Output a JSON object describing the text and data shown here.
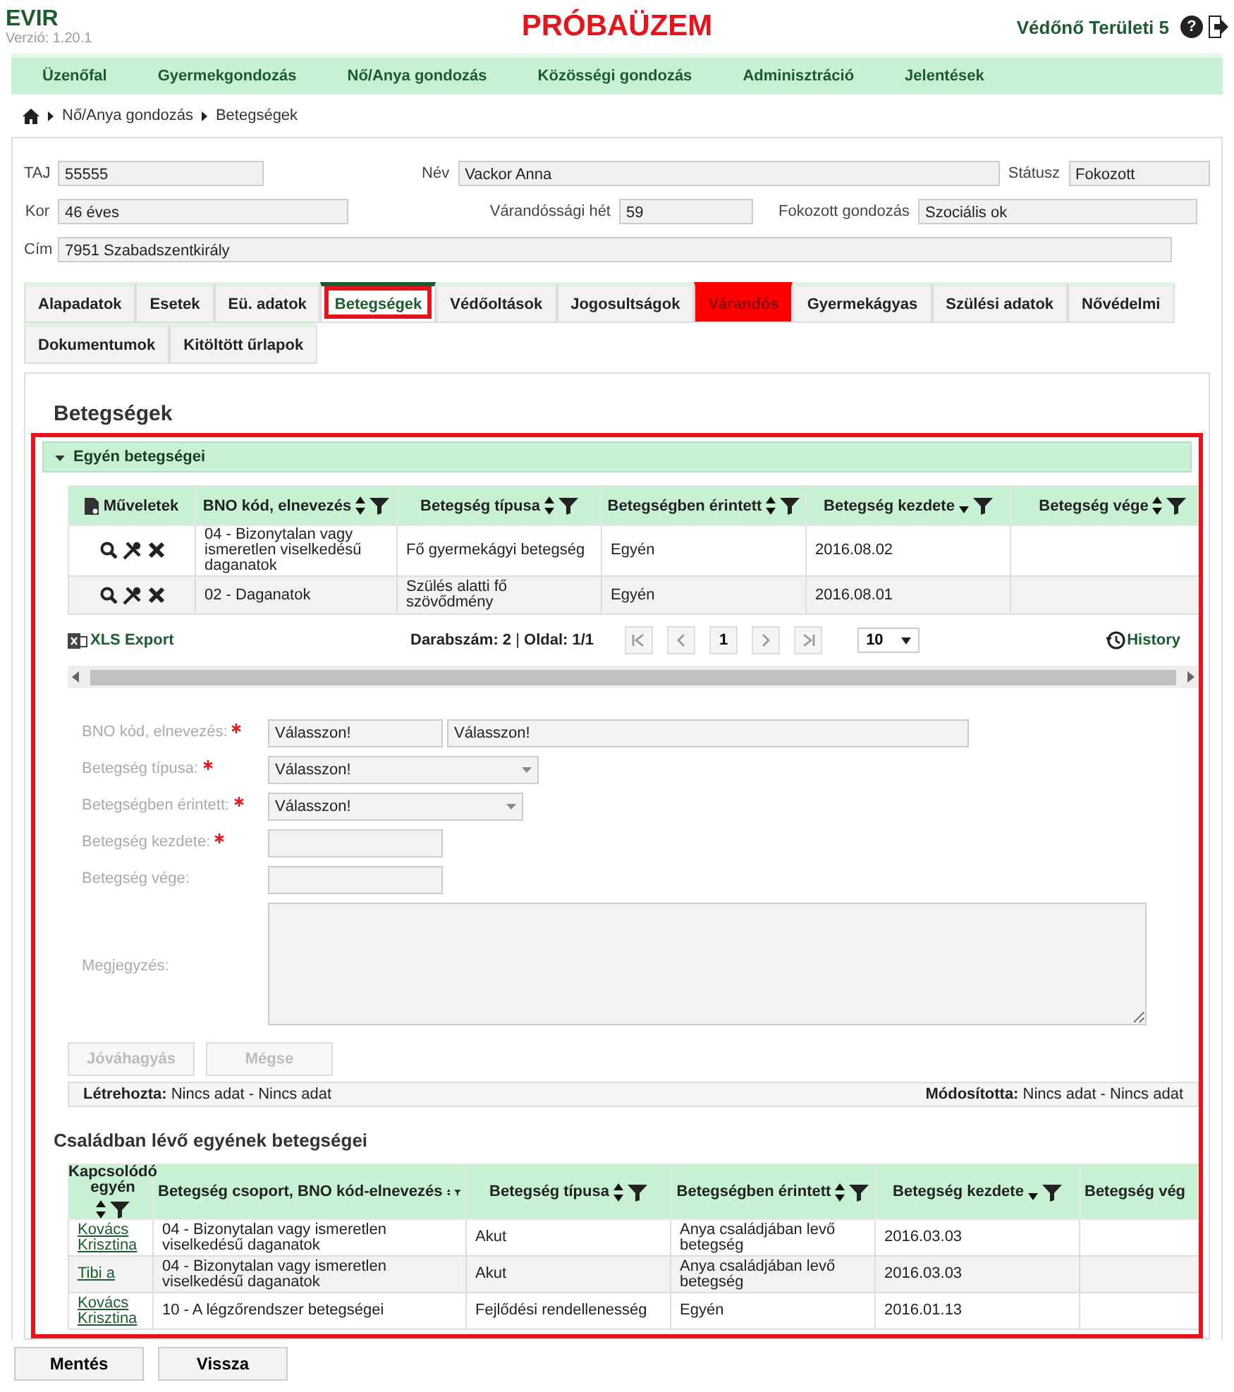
{
  "app": {
    "name": "EVIR",
    "version": "Verzió: 1.20.1"
  },
  "banner": "PRÓBAÜZEM",
  "user": "Védőnő Területi 5",
  "help": "?",
  "nav": [
    "Üzenőfal",
    "Gyermekgondozás",
    "Nő/Anya gondozás",
    "Közösségi gondozás",
    "Adminisztráció",
    "Jelentések"
  ],
  "breadcrumb": [
    "Nő/Anya gondozás",
    "Betegségek"
  ],
  "patient": [
    [
      {
        "label": "TAJ",
        "value": "55555"
      },
      {
        "label": "Név",
        "value": "Vackor Anna"
      },
      {
        "label": "Státusz",
        "value": "Fokozott"
      }
    ],
    [
      {
        "label": "Kor",
        "value": "46 éves"
      },
      {
        "label": "Várandóssági hét",
        "value": "59"
      },
      {
        "label": "Fokozott gondozás",
        "value": "Szociális ok"
      }
    ],
    [
      {
        "label": "Cím",
        "value": "7951 Szabadszentkirály"
      }
    ]
  ],
  "tabs": [
    [
      {
        "label": "Alapadatok",
        "selected": false,
        "alert": false,
        "highlighted": false
      },
      {
        "label": "Esetek",
        "selected": false,
        "alert": false,
        "highlighted": false
      },
      {
        "label": "Eü. adatok",
        "selected": false,
        "alert": false,
        "highlighted": false
      },
      {
        "label": "Betegségek",
        "selected": true,
        "alert": false,
        "highlighted": true
      },
      {
        "label": "Védőoltások",
        "selected": false,
        "alert": false,
        "highlighted": false
      },
      {
        "label": "Jogosultságok",
        "selected": false,
        "alert": false,
        "highlighted": false
      },
      {
        "label": "Várandós",
        "selected": false,
        "alert": true,
        "highlighted": false
      },
      {
        "label": "Gyermekágyas",
        "selected": false,
        "alert": false,
        "highlighted": false
      },
      {
        "label": "Szülési adatok",
        "selected": false,
        "alert": false,
        "highlighted": false
      },
      {
        "label": "Nővédelmi",
        "selected": false,
        "alert": false,
        "highlighted": false
      }
    ],
    [
      {
        "label": "Dokumentumok",
        "selected": false,
        "alert": false,
        "highlighted": false
      },
      {
        "label": "Kitöltött űrlapok",
        "selected": false,
        "alert": false,
        "highlighted": false
      }
    ]
  ],
  "page_title": "Betegségek",
  "section": {
    "highlighted": true,
    "title": "Egyén betegségei",
    "expanded": true,
    "table": {
      "columns": [
        {
          "label": "Műveletek",
          "kind": "actions"
        },
        {
          "label": "BNO kód, elnevezés",
          "kind": "text",
          "sortable": true,
          "filter": true
        },
        {
          "label": "Betegség típusa",
          "kind": "text",
          "sortable": true,
          "filter": true
        },
        {
          "label": "Betegségben érintett",
          "kind": "text",
          "sortable": true,
          "filter": true
        },
        {
          "label": "Betegség kezdete",
          "kind": "text",
          "sortable": true,
          "descending": true,
          "filter": true
        },
        {
          "label": "Betegség vége",
          "kind": "text",
          "sortable": true,
          "filter": true
        }
      ],
      "rows": [
        [
          "",
          "04 - Bizonytalan vagy ismeretlen viselkedésű daganatok",
          "Fő gyermekágyi betegség",
          "Egyén",
          "2016.08.02",
          ""
        ],
        [
          "",
          "02 - Daganatok",
          "Szülés alatti fő szövődmény",
          "Egyén",
          "2016.08.01",
          ""
        ]
      ]
    },
    "pager": {
      "export": "XLS Export",
      "summary": "**Darabszám: 2** | **Oldal: 1/1**",
      "page": "1",
      "page_size": "10",
      "history": "History"
    },
    "form": [
      {
        "label": "BNO kód, elnevezés:",
        "required": true,
        "kind": "pair",
        "values": [
          "Válasszon!",
          "Válasszon!"
        ]
      },
      {
        "label": "Betegség típusa:",
        "required": true,
        "kind": "select",
        "values": [
          "Válasszon!"
        ]
      },
      {
        "label": "Betegségben érintett:",
        "required": true,
        "kind": "select",
        "values": [
          "Válasszon!"
        ]
      },
      {
        "label": "Betegség kezdete:",
        "required": true,
        "kind": "text"
      },
      {
        "label": "Betegség vége:",
        "required": false,
        "kind": "text"
      },
      {
        "label": "Megjegyzés:",
        "required": false,
        "kind": "textarea"
      }
    ],
    "form_buttons": [
      {
        "label": "Jóváhagyás",
        "disabled": true
      },
      {
        "label": "Mégse",
        "disabled": true
      }
    ],
    "audit": {
      "created_label": "Létrehozta:",
      "created": "Nincs adat - Nincs adat",
      "modified_label": "Módosította:",
      "modified": "Nincs adat - Nincs adat"
    },
    "family": {
      "title": "Családban lévő egyének betegségei",
      "columns": [
        {
          "label": "Kapcsolódó egyén",
          "sortable": true,
          "filter": true
        },
        {
          "label": "Betegség csoport, BNO kód-elnevezés",
          "sortable": true,
          "filter": true
        },
        {
          "label": "Betegség típusa",
          "sortable": true,
          "filter": true
        },
        {
          "label": "Betegségben érintett",
          "sortable": true,
          "filter": true
        },
        {
          "label": "Betegség kezdete",
          "sortable": true,
          "descending": true,
          "filter": true
        },
        {
          "label": "Betegség vég"
        }
      ],
      "rows": [
        [
          "Kovács Krisztina",
          "04 - Bizonytalan vagy ismeretlen viselkedésű daganatok",
          "Akut",
          "Anya családjában levő betegség",
          "2016.03.03",
          ""
        ],
        [
          "Tibi a",
          "04 - Bizonytalan vagy ismeretlen viselkedésű daganatok",
          "Akut",
          "Anya családjában levő betegség",
          "2016.03.03",
          ""
        ],
        [
          "Kovács Krisztina",
          "10 - A légzőrendszer betegségei",
          "Fejlődési rendellenesség",
          "Egyén",
          "2016.01.13",
          ""
        ]
      ]
    }
  },
  "footer_buttons": [
    "Mentés",
    "Vissza"
  ]
}
